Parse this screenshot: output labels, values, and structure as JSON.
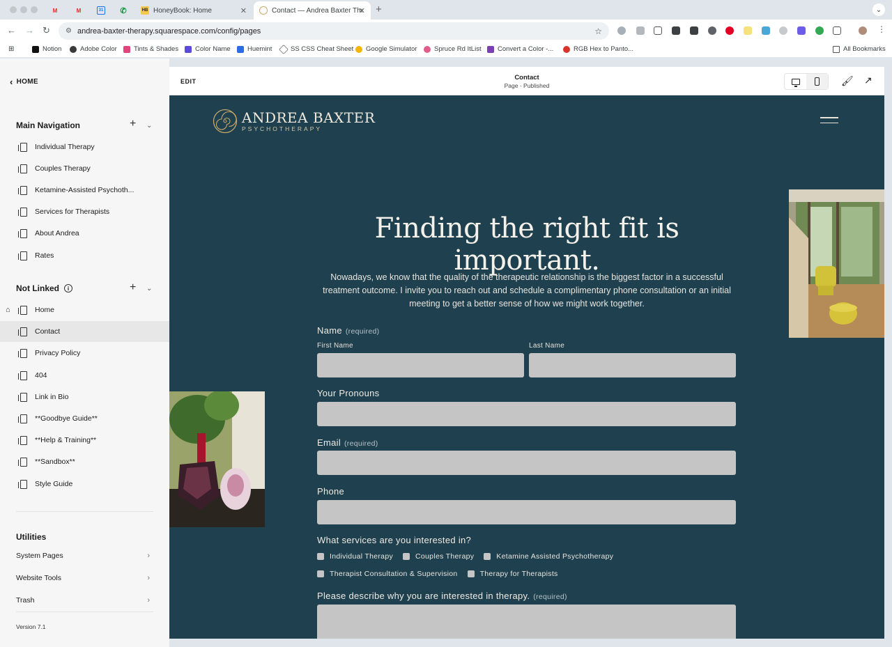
{
  "browser": {
    "tabs": [
      {
        "label": "",
        "icon": "gmail-icon"
      },
      {
        "label": "",
        "icon": "gmail-icon"
      },
      {
        "label": "",
        "icon": "calendar-icon"
      },
      {
        "label": "",
        "icon": "phone-icon"
      },
      {
        "label": "HoneyBook: Home",
        "icon": "honeybook-icon"
      },
      {
        "label": "Contact — Andrea Baxter The",
        "icon": "site-favicon"
      }
    ],
    "url": "andrea-baxter-therapy.squarespace.com/config/pages",
    "bookmarks": [
      {
        "label": "Notion",
        "color": "#111111"
      },
      {
        "label": "Adobe Color",
        "color": "#3a3a3a"
      },
      {
        "label": "Tints & Shades",
        "color": "#e0457b"
      },
      {
        "label": "Color Name",
        "color": "#5b4bd6"
      },
      {
        "label": "Huemint",
        "color": "#2d6cdf"
      },
      {
        "label": "SS CSS Cheat Sheet",
        "color": "#888888"
      },
      {
        "label": "Google Simulator",
        "color": "#f4b400"
      },
      {
        "label": "Spruce Rd ItList",
        "color": "#e25d8a"
      },
      {
        "label": "Convert a Color -...",
        "color": "#7a3fb0"
      },
      {
        "label": "RGB Hex to Panto...",
        "color": "#d9342b"
      }
    ],
    "all_bookmarks": "All Bookmarks"
  },
  "panel": {
    "home": "HOME",
    "main_nav_title": "Main Navigation",
    "main_nav": [
      "Individual Therapy",
      "Couples Therapy",
      "Ketamine-Assisted Psychoth...",
      "Services for Therapists",
      "About Andrea",
      "Rates"
    ],
    "not_linked_title": "Not Linked",
    "not_linked": [
      "Home",
      "Contact",
      "Privacy Policy",
      "404",
      "Link in Bio",
      "**Goodbye Guide**",
      "**Help & Training**",
      "**Sandbox**",
      "Style Guide"
    ],
    "utilities_title": "Utilities",
    "utilities": [
      "System Pages",
      "Website Tools",
      "Trash"
    ],
    "version": "Version 7.1"
  },
  "editor": {
    "edit": "EDIT",
    "page_name": "Contact",
    "page_status": "Page · Published"
  },
  "site": {
    "logo_name": "ANDREA BAXTER",
    "logo_sub": "PSYCHOTHERAPY",
    "headline": "Finding the right fit is important.",
    "intro": "Nowadays, we know that the quality of the therapeutic relationship is the biggest factor in a successful treatment outcome. I invite you to reach out and schedule a complimentary phone consultation or an initial meeting to get a better sense of how we might work together.",
    "form": {
      "name_label": "Name",
      "required": "(required)",
      "first_name": "First Name",
      "last_name": "Last Name",
      "pronouns_label": "Your Pronouns",
      "email_label": "Email",
      "phone_label": "Phone",
      "services_label": "What services are you interested in?",
      "services": [
        "Individual Therapy",
        "Couples Therapy",
        "Ketamine Assisted Psychotherapy",
        "Therapist Consultation & Supervision",
        "Therapy for Therapists"
      ],
      "describe_label": "Please describe why you are interested in therapy."
    },
    "colors": {
      "background": "#1f404f",
      "field": "#c4c5c4",
      "accent": "#c9a86a"
    }
  }
}
